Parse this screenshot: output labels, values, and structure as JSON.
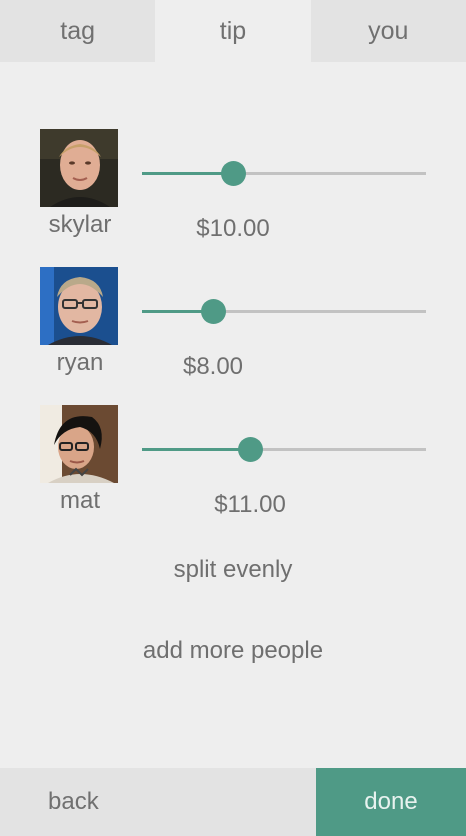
{
  "tabs": [
    {
      "label": "tag",
      "active": false
    },
    {
      "label": "tip",
      "active": true
    },
    {
      "label": "you",
      "active": false
    }
  ],
  "people": [
    {
      "name": "skylar",
      "amount": "$10.00",
      "slider_level": 0.32,
      "avatar": "skylar-avatar"
    },
    {
      "name": "ryan",
      "amount": "$8.00",
      "slider_level": 0.25,
      "avatar": "ryan-avatar"
    },
    {
      "name": "mat",
      "amount": "$11.00",
      "slider_level": 0.38,
      "avatar": "mat-avatar"
    }
  ],
  "actions": {
    "split_evenly": "split evenly",
    "add_more_people": "add more people"
  },
  "footer": {
    "back_label": "back",
    "done_label": "done"
  },
  "colors": {
    "accent": "#4f9a86",
    "background": "#eeeeee",
    "tab_inactive": "#e3e3e3",
    "track": "#c2c2c2",
    "text": "#6f6f6f"
  }
}
